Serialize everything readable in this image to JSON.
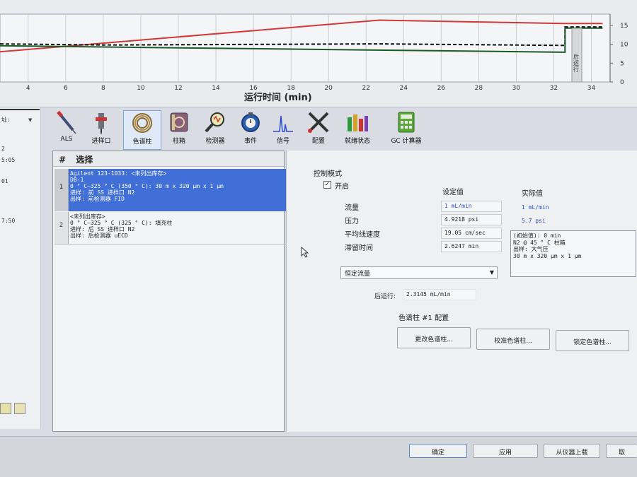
{
  "chart": {
    "xlabel": "运行时间 (min)",
    "x_ticks": [
      "4",
      "6",
      "8",
      "10",
      "12",
      "14",
      "16",
      "18",
      "20",
      "22",
      "24",
      "26",
      "28",
      "30",
      "32",
      "34"
    ],
    "y_ticks": [
      "15",
      "10",
      "5",
      "0"
    ],
    "side_label": "后运行"
  },
  "chart_data": {
    "type": "line",
    "xlabel": "运行时间 (min)",
    "xlim": [
      2.5,
      35
    ],
    "ylim": [
      0,
      18
    ],
    "x_ticks": [
      4,
      6,
      8,
      10,
      12,
      14,
      16,
      18,
      20,
      22,
      24,
      26,
      28,
      30,
      32,
      34
    ],
    "y_ticks": [
      0,
      5,
      10,
      15
    ],
    "series": [
      {
        "color": "#d03a3a",
        "x": [
          2.5,
          22.7,
          32.6,
          32.6,
          34.6
        ],
        "y": [
          8.0,
          16.4,
          15.5,
          15.5,
          15.5
        ]
      },
      {
        "color": "#111111",
        "style": "dashed",
        "x": [
          2.5,
          8.0,
          22.7,
          32.6,
          32.6,
          34.6
        ],
        "y": [
          10.1,
          9.8,
          10.1,
          9.7,
          14.6,
          14.6
        ]
      },
      {
        "color": "#1c5a2a",
        "x": [
          2.5,
          32.6,
          32.6,
          34.6
        ],
        "y": [
          9.6,
          7.9,
          14.3,
          14.3
        ]
      }
    ]
  },
  "left_strip": {
    "items": [
      "址:",
      "2",
      "5:05",
      "01",
      "7:50"
    ]
  },
  "toolbar": {
    "items": [
      {
        "label": "ALS"
      },
      {
        "label": "进样口"
      },
      {
        "label": "色谱柱"
      },
      {
        "label": "柱箱"
      },
      {
        "label": "检测器"
      },
      {
        "label": "事件"
      },
      {
        "label": "信号"
      },
      {
        "label": "配置"
      },
      {
        "label": "就绪状态"
      },
      {
        "label": "GC 计算器"
      }
    ]
  },
  "column_list": {
    "header_hash": "#",
    "header_label": "选择",
    "items": [
      {
        "index": "1",
        "line1": "Agilent 123-1033: <未列出库存>",
        "line2": "DB-1",
        "line3": "0 ° C—325 ° C (350 ° C): 30 m x 320 μm x 1 μm",
        "line4": "进样: 前 SS 进样口 N2",
        "line5": "出样: 前检测器 FID"
      },
      {
        "index": "2",
        "line1": "<未列出库存>",
        "line2": "0 ° C—325 ° C (325 ° C): 填充柱",
        "line3": "进样: 后 SS 进样口 N2",
        "line4": "出样: 后检测器 uECD"
      }
    ]
  },
  "settings": {
    "control_mode_label": "控制模式",
    "enable_label": "开启",
    "enabled_check": "✓",
    "setpoint_header": "设定值",
    "actual_header": "实际值",
    "rows": [
      {
        "label": "流量",
        "setpoint": "1 mL/min",
        "actual": "1 mL/min"
      },
      {
        "label": "压力",
        "setpoint": "4.9218 psi",
        "actual": "5.7 psi"
      },
      {
        "label": "平均线速度",
        "setpoint": "19.05 cm/sec"
      },
      {
        "label": "滞留时间",
        "setpoint": "2.6247 min"
      }
    ],
    "info_lines": [
      "(初始值): 0 min",
      "N2 @ 45 ° C 柱箱",
      "出样: 大气压",
      "30 m x 320 μm x 1 μm"
    ],
    "mode_value": "恒定流量",
    "postrun_label": "后运行:",
    "postrun_value": "2.3145 mL/min",
    "config_label": "色谱柱 #1 配置",
    "buttons": [
      "更改色谱柱...",
      "校准色谱柱...",
      "锁定色谱柱..."
    ]
  },
  "bottom_bar": {
    "buttons": [
      "确定",
      "应用",
      "从仪器上载",
      "取"
    ]
  }
}
